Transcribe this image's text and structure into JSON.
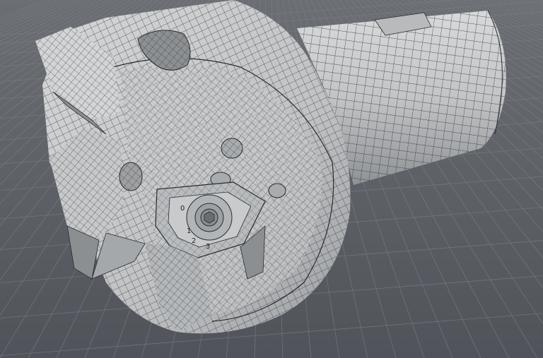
{
  "viewport": {
    "background_top": "#6b6f74",
    "background_bottom": "#4f5358",
    "grid_color": "#7c8086"
  },
  "model": {
    "surface_color": "#c4c6c8",
    "surface_shade": "#9a9d9f",
    "wire_color": "#2a2c2e",
    "insert_labels": [
      "0",
      "1",
      "2",
      "3"
    ]
  }
}
